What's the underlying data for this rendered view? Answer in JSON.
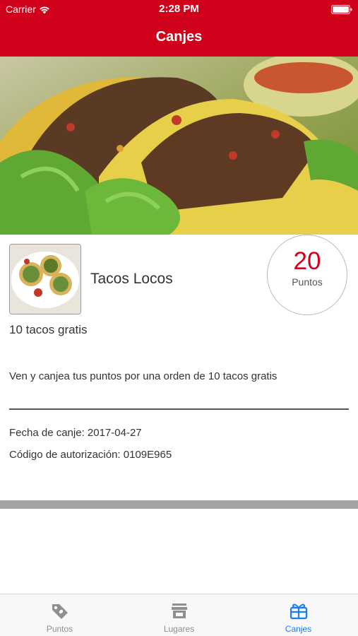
{
  "status_bar": {
    "carrier": "Carrier",
    "time": "2:28 PM",
    "wifi_icon": "wifi-icon",
    "battery_icon": "battery-icon"
  },
  "nav": {
    "title": "Canjes"
  },
  "hero": {
    "image": "tacos-photo"
  },
  "restaurant": {
    "name": "Tacos Locos",
    "thumbnail": "tacos-thumbnail"
  },
  "points": {
    "value": "20",
    "label": "Puntos"
  },
  "reward": {
    "title": "10 tacos gratis",
    "description": "Ven y canjea tus puntos por una orden de 10 tacos gratis",
    "redeem_date": "Fecha de canje: 2017-04-27",
    "auth_code": "Código de autorización: 0109E965"
  },
  "tabs": [
    {
      "label": "Puntos",
      "icon": "tag-icon",
      "active": false
    },
    {
      "label": "Lugares",
      "icon": "store-icon",
      "active": false
    },
    {
      "label": "Canjes",
      "icon": "gift-icon",
      "active": true
    }
  ],
  "colors": {
    "brand_red": "#d0021b",
    "active_tab": "#1a7cf5",
    "inactive_tab": "#8e8e93"
  }
}
